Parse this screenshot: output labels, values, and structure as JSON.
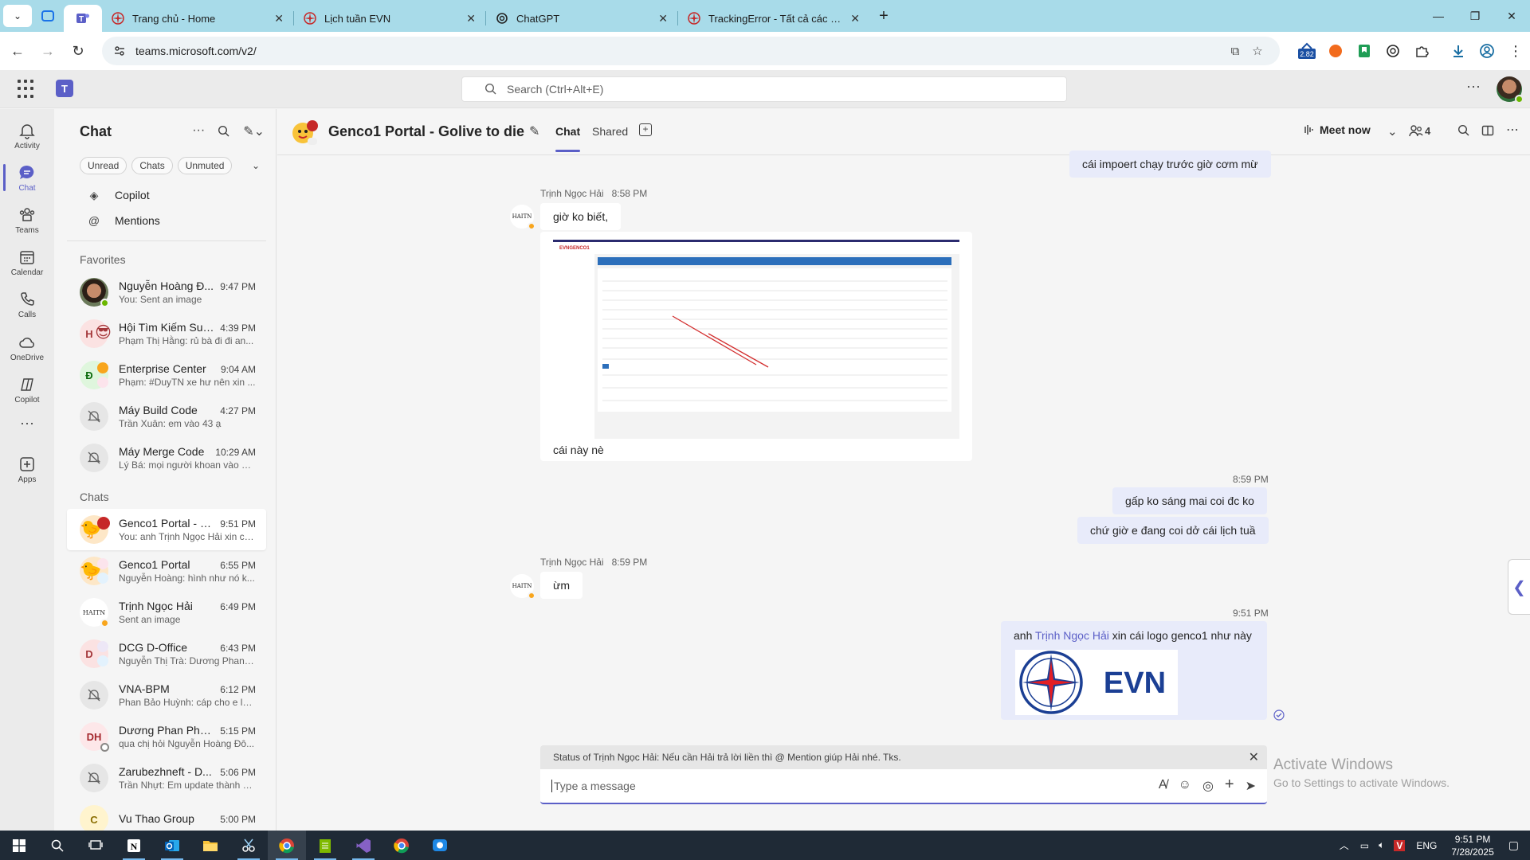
{
  "browser": {
    "tabs": [
      {
        "title": "Trang chủ - Home"
      },
      {
        "title": "Lịch tuần EVN"
      },
      {
        "title": "ChatGPT"
      },
      {
        "title": "TrackingError - Tất cả các Khoả"
      }
    ],
    "url": "teams.microsoft.com/v2/",
    "extension_badge": "2.82"
  },
  "teams": {
    "search_placeholder": "Search (Ctrl+Alt+E)"
  },
  "rail": [
    {
      "label": "Activity",
      "icon": "bell-icon"
    },
    {
      "label": "Chat",
      "icon": "chat-icon"
    },
    {
      "label": "Teams",
      "icon": "teams-icon"
    },
    {
      "label": "Calendar",
      "icon": "calendar-icon"
    },
    {
      "label": "Calls",
      "icon": "phone-icon"
    },
    {
      "label": "OneDrive",
      "icon": "cloud-icon"
    },
    {
      "label": "Copilot",
      "icon": "copilot-icon"
    },
    {
      "label": "Apps",
      "icon": "apps-icon"
    }
  ],
  "chatlist": {
    "title": "Chat",
    "filters": [
      "Unread",
      "Chats",
      "Unmuted"
    ],
    "quick": [
      "Copilot",
      "Mentions"
    ],
    "favorites_header": "Favorites",
    "chats_header": "Chats",
    "favorites": [
      {
        "name": "Nguyễn Hoàng Đ...",
        "time": "9:47 PM",
        "preview": "You: Sent an image"
      },
      {
        "name": "Hội Tìm Kiếm Sug...",
        "time": "4:39 PM",
        "preview": "Phạm Thị Hằng: rủ bà đi đi an..."
      },
      {
        "name": "Enterprise Center",
        "time": "9:04 AM",
        "preview": "Phạm: #DuyTN xe hư nên xin ..."
      },
      {
        "name": "Máy Build Code",
        "time": "4:27 PM",
        "preview": "Trần Xuân: em vào 43 ạ"
      },
      {
        "name": "Máy Merge Code",
        "time": "10:29 AM",
        "preview": "Lý Bá: mọi người khoan vào m..."
      }
    ],
    "chats": [
      {
        "name": "Genco1 Portal - G...",
        "time": "9:51 PM",
        "preview": "You: anh Trịnh Ngọc Hải xin cá..."
      },
      {
        "name": "Genco1 Portal",
        "time": "6:55 PM",
        "preview": "Nguyễn Hoàng: hình như nó k..."
      },
      {
        "name": "Trịnh Ngọc Hải",
        "time": "6:49 PM",
        "preview": "Sent an image"
      },
      {
        "name": "DCG D-Office",
        "time": "6:43 PM",
        "preview": "Nguyễn Thị Trà: Dương Phan P..."
      },
      {
        "name": "VNA-BPM",
        "time": "6:12 PM",
        "preview": "Phan Bảo Huỳnh: cáp cho e lu..."
      },
      {
        "name": "Dương Phan Phư...",
        "time": "5:15 PM",
        "preview": "qua chị hỏi Nguyễn Hoàng Đô..."
      },
      {
        "name": "Zarubezhneft - D...",
        "time": "5:06 PM",
        "preview": "Trần Nhựt: Em update thành 2..."
      },
      {
        "name": "Vu Thao Group",
        "time": "5:00 PM",
        "preview": ""
      }
    ],
    "avatar_initials": {
      "enterprise": "Đ",
      "dcg": "D",
      "duong": "DH",
      "hoi": "H",
      "vu": "C"
    }
  },
  "conversation": {
    "title": "Genco1 Portal - Golive to die",
    "tabs": [
      "Chat",
      "Shared"
    ],
    "meet_now": "Meet now",
    "participants": "4",
    "messages": {
      "m0": "cái impoert chạy trước giờ cơm mừ",
      "m1_sender": "Trịnh Ngọc Hải",
      "m1_time": "8:58 PM",
      "m1_text": "giờ ko biết,",
      "m1_caption": "cái này nè",
      "m2_time": "8:59 PM",
      "m2_a": "gấp ko sáng mai coi đc ko",
      "m2_b": "chứ giờ e đang coi dở cái lịch tuầ",
      "m3_sender": "Trịnh Ngọc Hải",
      "m3_time": "8:59 PM",
      "m3_text": "ừm",
      "m4_time": "9:51 PM",
      "m4_pre": "anh ",
      "m4_mention": "Trịnh Ngọc Hải",
      "m4_post": " xin cái logo genco1 như này",
      "evn_logo_text": "EVN",
      "sender_avatar_text": "HAITN"
    },
    "screenshot_brand": "EVNGENCO1",
    "status_note": "Status of Trịnh Ngọc Hải: Nếu cần Hải trả lời liền thì @ Mention giúp Hải nhé. Tks.",
    "composer_placeholder": "Type a message"
  },
  "watermark": {
    "line1": "Activate Windows",
    "line2": "Go to Settings to activate Windows."
  },
  "taskbar": {
    "lang": "ENG",
    "time": "9:51 PM",
    "date": "7/28/2025"
  },
  "colors": {
    "brand": "#5b5fc7",
    "my_bubble": "#e8ebfa",
    "evn_blue": "#1b3f94",
    "evn_red": "#e31e24"
  }
}
